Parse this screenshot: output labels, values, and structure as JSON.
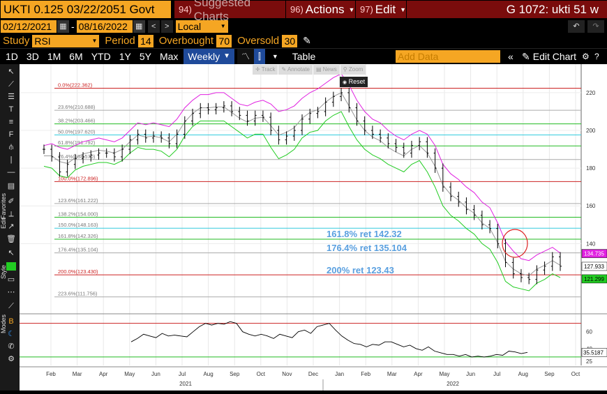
{
  "header": {
    "security": "UKTI 0.125 03/22/2051 Govt",
    "buttons": [
      {
        "num": "94)",
        "label": "Suggested Charts"
      },
      {
        "num": "96)",
        "label": "Actions"
      },
      {
        "num": "97)",
        "label": "Edit"
      }
    ],
    "right_title": "G 1072: ukti 51 w"
  },
  "dates": {
    "start": "02/12/2021",
    "end": "08/16/2022",
    "currency": "Local CCY"
  },
  "study": {
    "label": "Study",
    "value": "RSI",
    "period_label": "Period",
    "period": "14",
    "overbought_label": "Overbought",
    "overbought": "70",
    "oversold_label": "Oversold",
    "oversold": "30"
  },
  "toolbar": {
    "ranges": [
      "1D",
      "3D",
      "1M",
      "6M",
      "YTD",
      "1Y",
      "5Y",
      "Max"
    ],
    "frequency": "Weekly",
    "table_label": "Table",
    "add_data_placeholder": "Add Data",
    "edit_chart": "Edit Chart"
  },
  "mini_toolbar": {
    "track": "Track",
    "annotate": "Annotate",
    "news": "News",
    "zoom": "Zoom",
    "reset": "Reset"
  },
  "left_labels": {
    "favorites": "Favorites",
    "edit": "Edit",
    "style": "Style",
    "modes": "Modes"
  },
  "colors": {
    "price": "#000000",
    "upper_band": "#e020e0",
    "lower_band": "#22cc22",
    "mid_band": "#999999",
    "fib_red": "#cc2222",
    "fib_gray": "#aaaaaa",
    "fib_green": "#22bb22",
    "fib_cyan": "#33ccdd",
    "annotation": "#5aa0e0"
  },
  "chart_data": [
    {
      "type": "line",
      "title": "",
      "x_months": [
        "Feb",
        "Mar",
        "Apr",
        "May",
        "Jun",
        "Jul",
        "Aug",
        "Sep",
        "Oct",
        "Nov",
        "Dec",
        "Jan",
        "Feb",
        "Mar",
        "Apr",
        "May",
        "Jun",
        "Jul",
        "Aug",
        "Sep",
        "Oct"
      ],
      "x_years": [
        "2021",
        "2022"
      ],
      "y_ticks": [
        140,
        160,
        180,
        200,
        220
      ],
      "ylim": [
        105,
        227
      ],
      "price_labels": {
        "upper": "134.735",
        "last": "127.933",
        "lower": "121.299"
      },
      "fib_levels": [
        {
          "label": "0.0%(222.362)",
          "value": 222.362,
          "color": "red"
        },
        {
          "label": "23.6%(210.688)",
          "value": 210.688,
          "color": "gray"
        },
        {
          "label": "38.2%(203.466)",
          "value": 203.466,
          "color": "green"
        },
        {
          "label": "50.0%(197.620)",
          "value": 197.62,
          "color": "cyan"
        },
        {
          "label": "61.8%(191.792)",
          "value": 191.792,
          "color": "green"
        },
        {
          "label": "76.4%(184.570)",
          "value": 184.57,
          "color": "gray"
        },
        {
          "label": "100.0%(172.896)",
          "value": 172.896,
          "color": "red"
        },
        {
          "label": "123.6%(161.222)",
          "value": 161.222,
          "color": "gray"
        },
        {
          "label": "138.2%(154.000)",
          "value": 154.0,
          "color": "green"
        },
        {
          "label": "150.0%(148.163)",
          "value": 148.163,
          "color": "cyan"
        },
        {
          "label": "161.8%(142.326)",
          "value": 142.326,
          "color": "green"
        },
        {
          "label": "176.4%(135.104)",
          "value": 135.104,
          "color": "gray"
        },
        {
          "label": "200.0%(123.430)",
          "value": 123.43,
          "color": "red"
        },
        {
          "label": "223.6%(111.756)",
          "value": 111.756,
          "color": "gray"
        }
      ],
      "annotations": [
        "161.8% ret 142.32",
        "176.4% ret 135.104",
        "200% ret 123.43"
      ],
      "price": [
        190,
        186,
        178,
        182,
        185,
        186,
        187,
        188,
        188,
        186,
        190,
        195,
        198,
        196,
        197,
        196,
        193,
        198,
        205,
        209,
        212,
        211,
        212,
        213,
        210,
        208,
        205,
        208,
        207,
        200,
        195,
        197,
        200,
        206,
        209,
        210,
        215,
        218,
        220,
        212,
        205,
        200,
        198,
        196,
        193,
        191,
        188,
        192,
        194,
        188,
        180,
        170,
        165,
        162,
        158,
        155,
        150,
        148,
        140,
        130,
        124,
        122,
        121,
        126,
        128,
        133,
        128
      ],
      "upper_band": [
        192,
        193,
        191,
        190,
        192,
        194,
        195,
        196,
        195,
        194,
        196,
        200,
        204,
        203,
        204,
        203,
        202,
        206,
        212,
        216,
        219,
        219,
        220,
        220,
        217,
        214,
        213,
        215,
        216,
        214,
        210,
        211,
        213,
        217,
        220,
        222,
        225,
        228,
        230,
        224,
        216,
        210,
        206,
        204,
        200,
        197,
        195,
        198,
        200,
        198,
        192,
        182,
        177,
        174,
        170,
        167,
        162,
        159,
        151,
        141,
        136,
        132,
        131,
        134,
        136,
        138,
        135
      ],
      "lower_band": [
        181,
        180,
        176,
        175,
        179,
        181,
        182,
        183,
        183,
        182,
        184,
        188,
        191,
        190,
        190,
        189,
        186,
        190,
        197,
        202,
        205,
        205,
        205,
        205,
        202,
        199,
        196,
        198,
        198,
        191,
        185,
        187,
        190,
        196,
        199,
        200,
        205,
        208,
        210,
        202,
        195,
        190,
        187,
        185,
        182,
        180,
        178,
        182,
        184,
        178,
        170,
        160,
        155,
        152,
        148,
        145,
        140,
        137,
        130,
        120,
        117,
        116,
        115,
        119,
        121,
        124,
        122
      ]
    },
    {
      "type": "line",
      "title": "RSI",
      "y_ticks": [
        25,
        40,
        60
      ],
      "ylim": [
        20,
        78
      ],
      "last_label": "35.5187",
      "overbought": 70,
      "oversold": 30,
      "rsi": [
        48,
        52,
        57,
        55,
        53,
        58,
        55,
        56,
        55,
        54,
        60,
        66,
        70,
        68,
        70,
        69,
        72,
        70,
        60,
        57,
        55,
        57,
        55,
        52,
        57,
        55,
        53,
        60,
        62,
        58,
        66,
        68,
        70,
        62,
        55,
        50,
        46,
        45,
        42,
        45,
        44,
        48,
        48,
        45,
        42,
        44,
        40,
        38,
        42,
        37,
        35,
        33,
        33,
        31,
        33,
        30,
        31,
        30,
        31,
        33,
        32,
        37,
        36,
        34,
        35.5
      ]
    }
  ]
}
